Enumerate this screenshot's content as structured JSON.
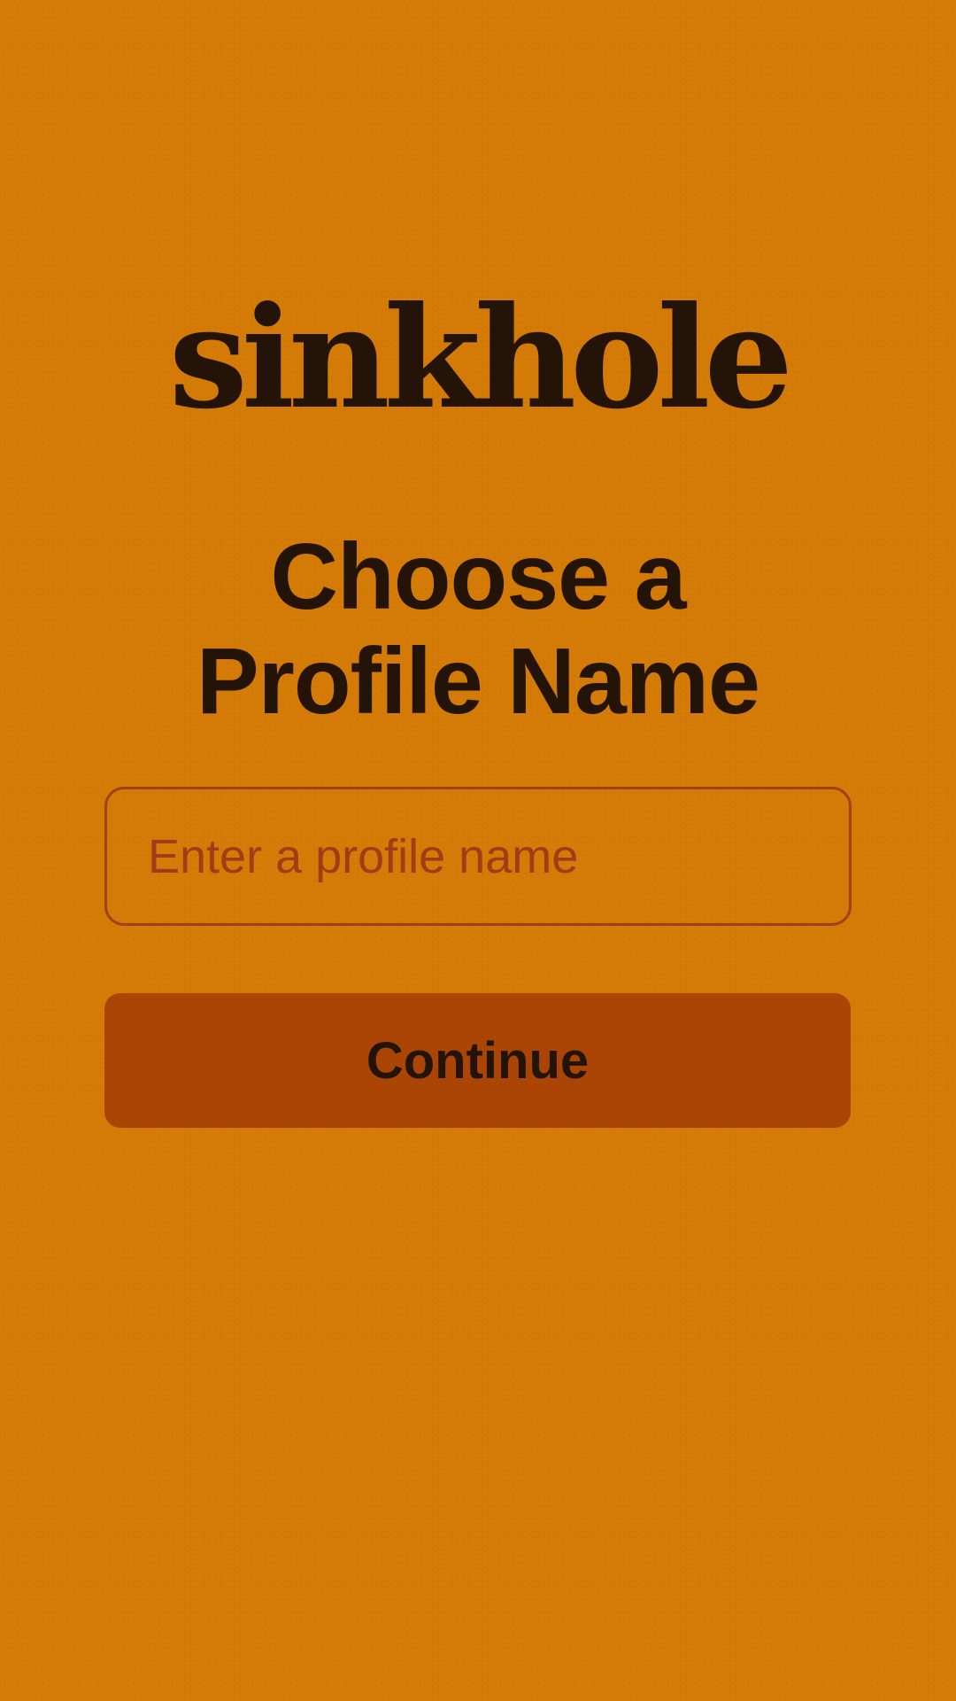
{
  "app": {
    "logo_text": "sinkhole"
  },
  "main": {
    "title": "Choose a\nProfile Name",
    "profile_input": {
      "value": "",
      "placeholder": "Enter a profile name"
    },
    "continue_label": "Continue"
  },
  "colors": {
    "background": "#d47a06",
    "text": "#241408",
    "input_border": "#a2401a",
    "placeholder": "#a23b16",
    "button_background": "#aa4505"
  }
}
